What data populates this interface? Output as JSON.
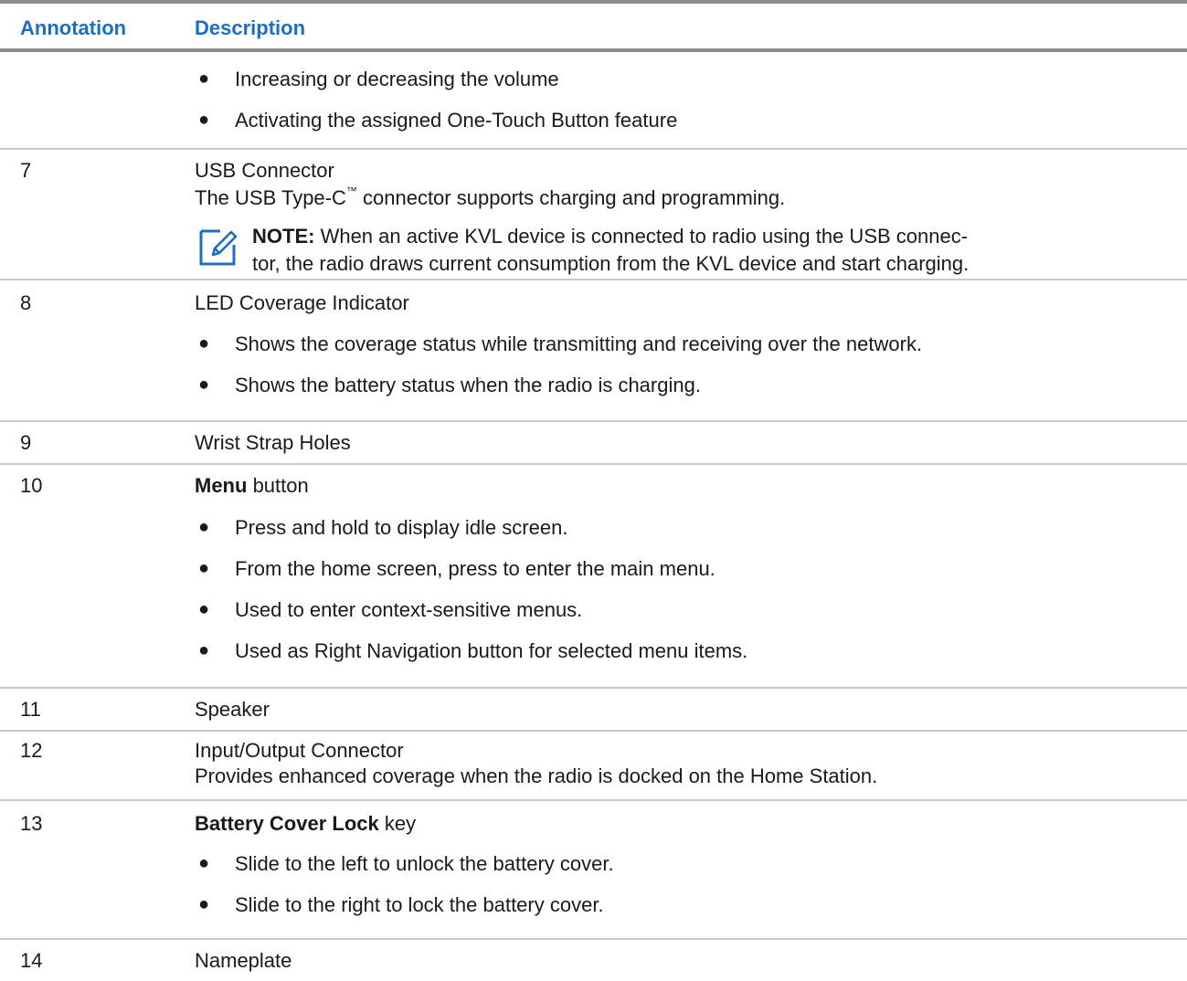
{
  "header": {
    "annotation": "Annotation",
    "description": "Description"
  },
  "row_cont": {
    "bullets": [
      "Increasing or decreasing the volume",
      "Activating the assigned One-Touch Button feature"
    ]
  },
  "row7": {
    "num": "7",
    "title": "USB Connector",
    "desc_pre": "The USB Type-C",
    "desc_tm": "™",
    "desc_post": " connector supports charging and programming.",
    "note_label": "NOTE:",
    "note_line1": " When an active KVL device is connected to radio using the USB connec-",
    "note_line2": "tor, the radio draws current consumption from the KVL device and start charging.",
    "note_icon": "note-pencil-icon"
  },
  "row8": {
    "num": "8",
    "title": "LED Coverage Indicator",
    "bullets": [
      "Shows the coverage status while transmitting and receiving over the network.",
      "Shows the battery status when the radio is charging."
    ]
  },
  "row9": {
    "num": "9",
    "title": "Wrist Strap Holes"
  },
  "row10": {
    "num": "10",
    "title_bold": "Menu",
    "title_rest": " button",
    "bullets": [
      "Press and hold to display idle screen.",
      "From the home screen, press to enter the main menu.",
      "Used to enter context-sensitive menus.",
      "Used as Right Navigation button for selected menu items."
    ]
  },
  "row11": {
    "num": "11",
    "title": "Speaker"
  },
  "row12": {
    "num": "12",
    "title": "Input/Output Connector",
    "desc": "Provides enhanced coverage when the radio is docked on the Home Station."
  },
  "row13": {
    "num": "13",
    "title_bold": "Battery Cover Lock",
    "title_rest": " key",
    "bullets": [
      "Slide to the left to unlock the battery cover.",
      "Slide to the right to lock the battery cover."
    ]
  },
  "row14": {
    "num": "14",
    "title": "Nameplate"
  },
  "bullet_char": "●"
}
